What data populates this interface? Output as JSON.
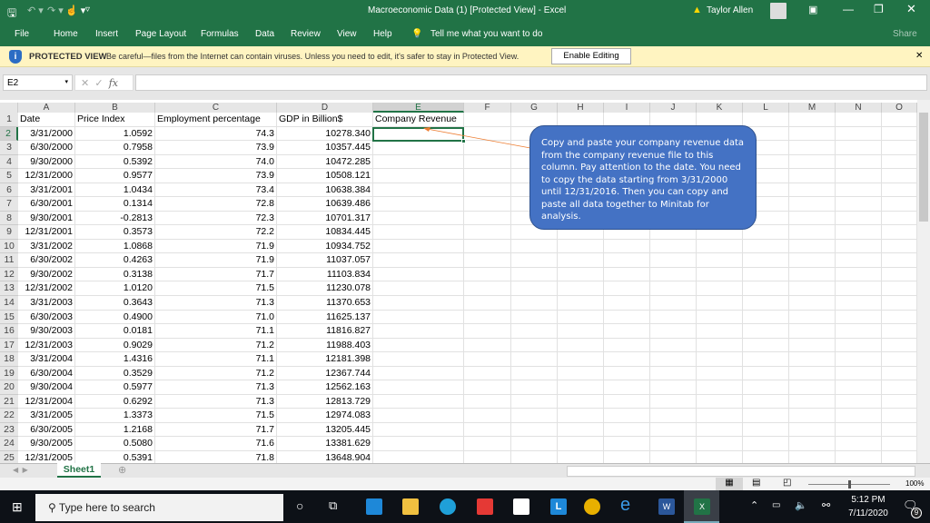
{
  "window": {
    "title": "Macroeconomic Data (1)  [Protected View]  -  Excel",
    "user": "Taylor Allen"
  },
  "ribbon": {
    "tabs": [
      "File",
      "Home",
      "Insert",
      "Page Layout",
      "Formulas",
      "Data",
      "Review",
      "View",
      "Help"
    ],
    "tell_me": "Tell me what you want to do",
    "share": "Share"
  },
  "protected": {
    "label": "PROTECTED VIEW",
    "message": "Be careful—files from the Internet can contain viruses. Unless you need to edit, it's safer to stay in Protected View.",
    "button": "Enable Editing"
  },
  "formula_bar": {
    "name_box": "E2",
    "fx": "fx",
    "value": ""
  },
  "columns": [
    "A",
    "B",
    "C",
    "D",
    "E",
    "F",
    "G",
    "H",
    "I",
    "J",
    "K",
    "L",
    "M",
    "N",
    "O"
  ],
  "headers": [
    "Date",
    "Price Index",
    "Employment percentage",
    "GDP  in Billion$",
    "Company Revenue"
  ],
  "rows": [
    [
      "3/31/2000",
      "1.0592",
      "74.3",
      "10278.340"
    ],
    [
      "6/30/2000",
      "0.7958",
      "73.9",
      "10357.445"
    ],
    [
      "9/30/2000",
      "0.5392",
      "74.0",
      "10472.285"
    ],
    [
      "12/31/2000",
      "0.9577",
      "73.9",
      "10508.121"
    ],
    [
      "3/31/2001",
      "1.0434",
      "73.4",
      "10638.384"
    ],
    [
      "6/30/2001",
      "0.1314",
      "72.8",
      "10639.486"
    ],
    [
      "9/30/2001",
      "-0.2813",
      "72.3",
      "10701.317"
    ],
    [
      "12/31/2001",
      "0.3573",
      "72.2",
      "10834.445"
    ],
    [
      "3/31/2002",
      "1.0868",
      "71.9",
      "10934.752"
    ],
    [
      "6/30/2002",
      "0.4263",
      "71.9",
      "11037.057"
    ],
    [
      "9/30/2002",
      "0.3138",
      "71.7",
      "11103.834"
    ],
    [
      "12/31/2002",
      "1.0120",
      "71.5",
      "11230.078"
    ],
    [
      "3/31/2003",
      "0.3643",
      "71.3",
      "11370.653"
    ],
    [
      "6/30/2003",
      "0.4900",
      "71.0",
      "11625.137"
    ],
    [
      "9/30/2003",
      "0.0181",
      "71.1",
      "11816.827"
    ],
    [
      "12/31/2003",
      "0.9029",
      "71.2",
      "11988.403"
    ],
    [
      "3/31/2004",
      "1.4316",
      "71.1",
      "12181.398"
    ],
    [
      "6/30/2004",
      "0.3529",
      "71.2",
      "12367.744"
    ],
    [
      "9/30/2004",
      "0.5977",
      "71.3",
      "12562.163"
    ],
    [
      "12/31/2004",
      "0.6292",
      "71.3",
      "12813.729"
    ],
    [
      "3/31/2005",
      "1.3373",
      "71.5",
      "12974.083"
    ],
    [
      "6/30/2005",
      "1.2168",
      "71.7",
      "13205.445"
    ],
    [
      "9/30/2005",
      "0.5080",
      "71.6",
      "13381.629"
    ],
    [
      "12/31/2005",
      "0.5391",
      "71.8",
      "13648.904"
    ]
  ],
  "callout": "Copy and paste your company revenue data from the company revenue file to this column. Pay attention to the date. You need to copy the data starting from 3/31/2000 until 12/31/2016. Then you can copy and paste all data together to Minitab for analysis.",
  "sheet_tab": "Sheet1",
  "status": {
    "zoom": "100%"
  },
  "taskbar": {
    "search_placeholder": "Type here to search",
    "time": "5:12 PM",
    "date": "7/11/2020",
    "notifications": "9"
  },
  "colors": {
    "excel_green": "#217346",
    "callout_blue": "#4472c4",
    "arrow": "#ed7d31"
  }
}
